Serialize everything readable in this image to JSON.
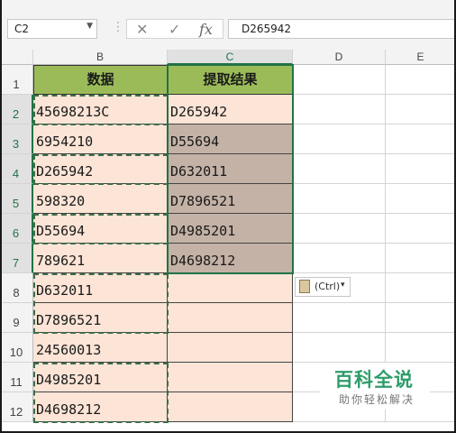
{
  "formula_bar": {
    "name_box": "C2",
    "cancel_glyph": "✕",
    "enter_glyph": "✓",
    "fx_label": "fx",
    "formula_value": "D265942"
  },
  "columns": [
    "B",
    "C",
    "D",
    "E"
  ],
  "rows": [
    "1",
    "2",
    "3",
    "4",
    "5",
    "6",
    "7",
    "8",
    "9",
    "10",
    "11",
    "12"
  ],
  "sheet": {
    "header_b": "数据",
    "header_c": "提取结果",
    "col_b": [
      "45698213C",
      "6954210",
      "D265942",
      "598320",
      "D55694",
      "789621",
      "D632011",
      "D7896521",
      "24560013",
      "D4985201",
      "D4698212"
    ],
    "col_c": [
      "D265942",
      "D55694",
      "D632011",
      "D7896521",
      "D4985201",
      "D4698212",
      "",
      "",
      "",
      "",
      ""
    ]
  },
  "paste_options": {
    "label": "(Ctrl)",
    "arrow": "▾"
  },
  "watermark": {
    "title": "百科全说",
    "subtitle": "助你轻松解决"
  },
  "colors": {
    "header_green": "#9bbb59",
    "peach": "#fce4d6",
    "taupe": "#c4b2a6",
    "selection": "#217346"
  }
}
